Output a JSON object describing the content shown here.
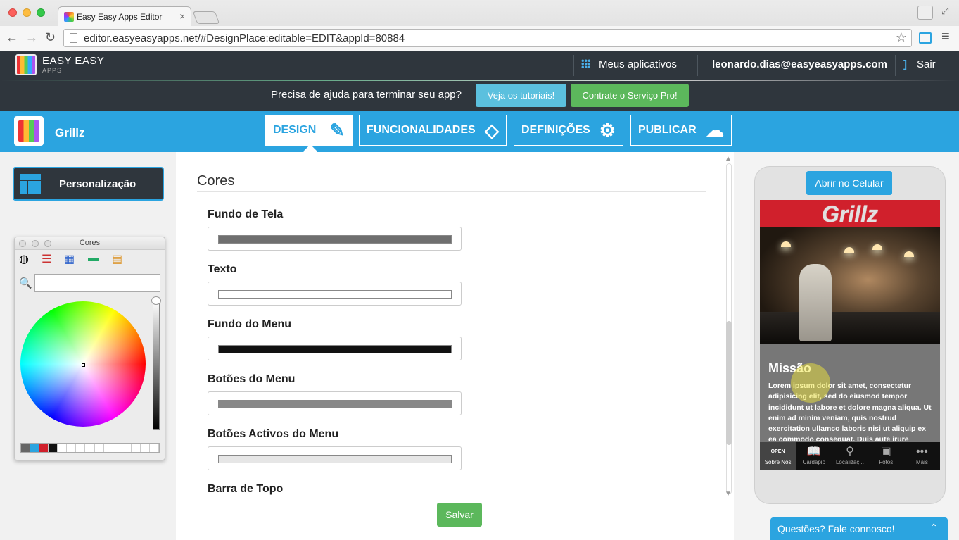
{
  "browser": {
    "tab_title": "Easy Easy Apps Editor",
    "tab_close": "×",
    "url": "editor.easyeasyapps.net/#DesignPlace:editable=EDIT&appId=80884",
    "back": "←",
    "forward": "→",
    "reload": "↻",
    "star": "☆",
    "menu": "≡"
  },
  "app_header": {
    "brand": "EASY EASY",
    "brand_sub": "APPS",
    "my_apps": "Meus aplicativos",
    "email": "leonardo.dias@easyeasyapps.com",
    "logout": "Sair",
    "logout_icon": "]"
  },
  "help_bar": {
    "text": "Precisa de ajuda para terminar seu app?",
    "tutorials": "Veja os tutoriais!",
    "pro": "Contrate o Serviço Pro!"
  },
  "nav": {
    "app_name": "Grillz",
    "tabs": [
      {
        "label": "DESIGN",
        "icon": "brush-icon",
        "glyph": "✎"
      },
      {
        "label": "FUNCIONALIDADES",
        "icon": "tags-icon",
        "glyph": "◇"
      },
      {
        "label": "DEFINIÇÕES",
        "icon": "gear-icon",
        "glyph": "⚙"
      },
      {
        "label": "PUBLICAR",
        "icon": "cloud-upload-icon",
        "glyph": "☁"
      }
    ]
  },
  "sidebar": {
    "personalization": "Personalização"
  },
  "color_picker": {
    "title": "Cores",
    "search_icon": "🔍",
    "tabs": [
      "◍",
      "☰",
      "▦",
      "▬",
      "▤"
    ]
  },
  "content": {
    "heading": "Cores",
    "fields": [
      {
        "label": "Fundo de Tela",
        "color": "#6f6f6f"
      },
      {
        "label": "Texto",
        "color": "#ffffff"
      },
      {
        "label": "Fundo do Menu",
        "color": "#111111"
      },
      {
        "label": "Botões do Menu",
        "color": "#888888"
      },
      {
        "label": "Botões Activos do Menu",
        "color": "#e6e6e6"
      },
      {
        "label": "Barra de Topo"
      }
    ],
    "save": "Salvar",
    "scroll_up": "▲",
    "scroll_down": "▼"
  },
  "phone": {
    "open_button": "Abrir no Celular",
    "title": "Grillz",
    "heading": "Missão",
    "text": "Lorem ipsum dolor sit amet, consectetur adipisicing elit, sed do eiusmod tempor incididunt ut labore et dolore magna aliqua. Ut enim ad minim veniam, quis nostrud exercitation ullamco laboris nisi ut aliquip ex ea commodo consequat. Duis aute irure",
    "nav": [
      {
        "label": "Sobre Nós",
        "icon": "open-sign-icon",
        "glyph": "OPEN"
      },
      {
        "label": "Cardápio",
        "icon": "book-icon",
        "glyph": "📖"
      },
      {
        "label": "Localizaç...",
        "icon": "map-pin-icon",
        "glyph": "⚲"
      },
      {
        "label": "Fotos",
        "icon": "photo-icon",
        "glyph": "▣"
      },
      {
        "label": "Mais",
        "icon": "more-icon",
        "glyph": "•••"
      }
    ]
  },
  "chat": {
    "text": "Questões? Fale connosco!",
    "caret": "⌃"
  },
  "colors": {
    "accent": "#2ba4e0",
    "dark": "#2f363d",
    "green": "#5cb85c",
    "cyan": "#5bc0de",
    "brand_red": "#d0202c"
  }
}
